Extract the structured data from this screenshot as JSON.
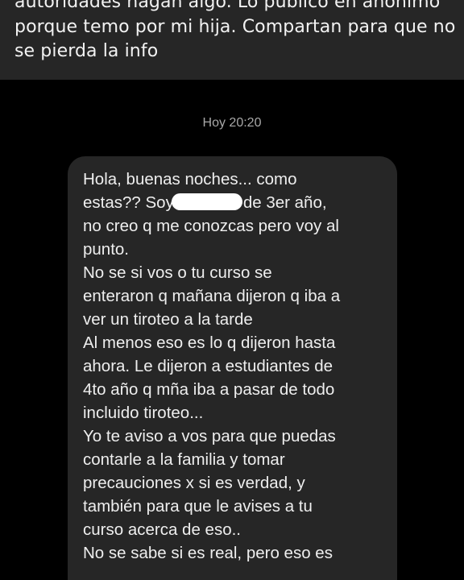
{
  "caption": {
    "lines": [
      "autoridades hagan algo. Lo publico en anonimo",
      "porque temo por mi hija. Compartan para que no",
      "se pierda la info"
    ]
  },
  "chat": {
    "timestamp": "Hoy 20:20",
    "message": {
      "line_1": "Hola, buenas noches... como",
      "line_2_before": "estas?? Soy",
      "line_2_after": "de 3er año,",
      "lines_rest": [
        "no creo q me conozcas pero voy al",
        "punto.",
        "No se si vos o tu curso se",
        "enteraron q mañana dijeron q iba a",
        "ver un tiroteo a la tarde",
        "Al menos eso es lo q dijeron hasta",
        "ahora. Le dijeron a estudiantes de",
        "4to año q mña iba a pasar de todo",
        "incluido tiroteo...",
        "Yo te aviso a vos para que puedas",
        "contarle a la familia y tomar",
        "precauciones x si es verdad, y",
        "también para que le avises a tu",
        "curso acerca de eso..",
        "No se sabe si es real, pero eso es"
      ]
    }
  }
}
